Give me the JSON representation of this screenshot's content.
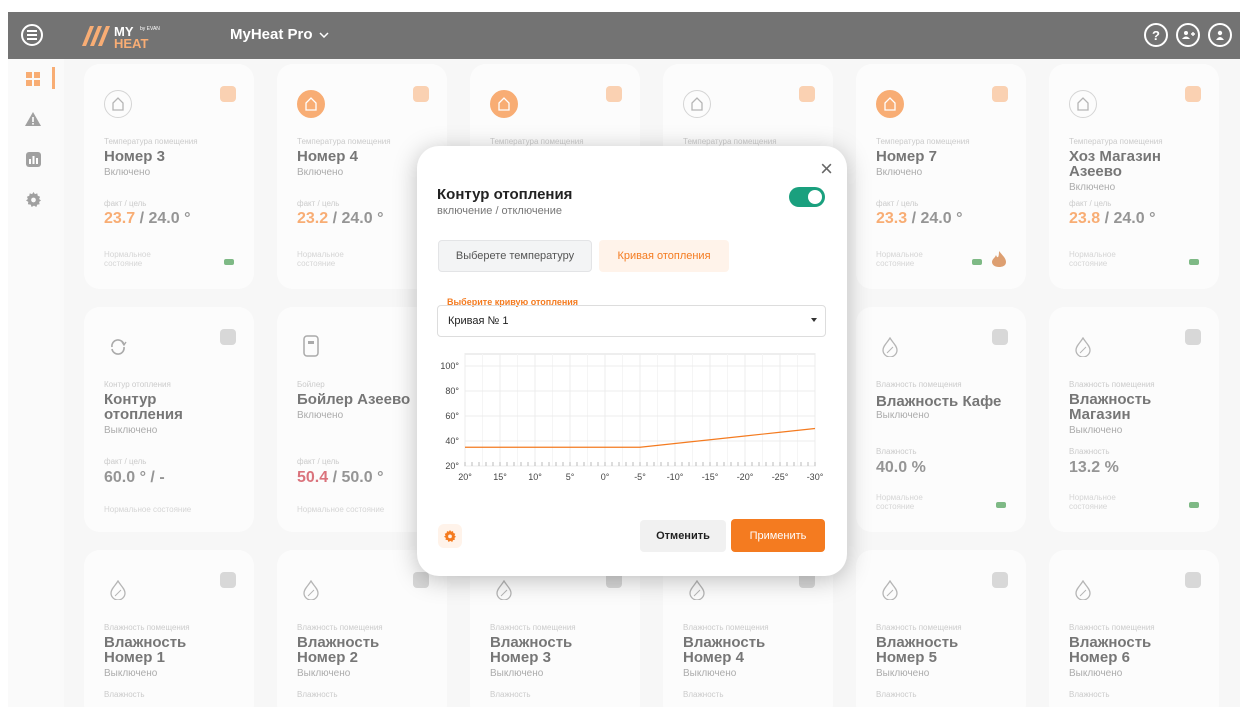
{
  "app": {
    "logo_text": "MY HEAT by EVAN",
    "title": "MyHeat Pro"
  },
  "topbar": {
    "help_icon": "question-icon",
    "help_label": "?",
    "add_user_icon": "add-user-icon",
    "add_user_label": "+",
    "profile_icon": "user-icon",
    "profile_label": "●"
  },
  "sidebar": {
    "items": [
      {
        "icon": "dashboard-icon",
        "active": true
      },
      {
        "icon": "warning-icon",
        "active": false
      },
      {
        "icon": "chart-icon",
        "active": false
      },
      {
        "icon": "gear-icon",
        "active": false
      }
    ]
  },
  "cards_row1": [
    {
      "caption": "Температура помещения",
      "name": "Номер 3",
      "state": "Включено",
      "fact_label": "факт / цель",
      "value_a": "23.7",
      "value_b": " / 24.0 °",
      "footer": "Нормальное состояние",
      "icon_on": false
    },
    {
      "caption": "Температура помещения",
      "name": "Номер 4",
      "state": "Включено",
      "fact_label": "факт / цель",
      "value_a": "23.2",
      "value_b": " / 24.0 °",
      "footer": "Нормальное состояние",
      "icon_on": true
    },
    {
      "caption": "Температура помещения",
      "name": "",
      "state": "",
      "fact_label": "",
      "value_a": "",
      "value_b": "",
      "footer": "",
      "icon_on": true
    },
    {
      "caption": "Температура помещения",
      "name": "",
      "state": "",
      "fact_label": "",
      "value_a": "",
      "value_b": "",
      "footer": "",
      "icon_on": false
    },
    {
      "caption": "Температура помещения",
      "name": "Номер 7",
      "state": "Включено",
      "fact_label": "факт / цель",
      "value_a": "23.3",
      "value_b": " / 24.0 °",
      "footer": "Нормальное состояние",
      "icon_on": true
    },
    {
      "caption": "Температура помещения",
      "name": "Хоз Магазин Азеево",
      "state": "Включено",
      "fact_label": "факт / цель",
      "value_a": "23.8",
      "value_b": " / 24.0 °",
      "footer": "Нормальное состояние",
      "icon_on": false
    }
  ],
  "cards_row2": [
    {
      "caption": "Контур отопления",
      "name": "Контур отопления",
      "state": "Выключено",
      "fact_label": "факт / цель",
      "value_a": "",
      "value_b": "60.0 ° / -",
      "footer": "Нормальное состояние"
    },
    {
      "caption": "Бойлер",
      "name": "Бойлер Азеево",
      "state": "Включено",
      "fact_label": "факт / цель",
      "value_a": "50.4",
      "value_b": " / 50.0 °",
      "footer": "Нормальное состояние"
    },
    {
      "caption": "Влажность помещения",
      "name": "Влажность Кафе",
      "state": "Выключено",
      "fact_label": "Влажность",
      "value_a": "",
      "value_b": "40.0 %",
      "footer": "Нормальное состояние"
    },
    {
      "caption": "Влажность помещения",
      "name": "Влажность Магазин",
      "state": "Выключено",
      "fact_label": "Влажность",
      "value_a": "",
      "value_b": "13.2 %",
      "footer": "Нормальное состояние"
    }
  ],
  "cards_row3": [
    {
      "caption": "Влажность помещения",
      "name": "Влажность Номер 1",
      "state": "Выключено",
      "fact_label": "Влажность"
    },
    {
      "caption": "Влажность помещения",
      "name": "Влажность Номер 2",
      "state": "Выключено",
      "fact_label": "Влажность"
    },
    {
      "caption": "Влажность помещения",
      "name": "Влажность Номер 3",
      "state": "Выключено",
      "fact_label": "Влажность"
    },
    {
      "caption": "Влажность помещения",
      "name": "Влажность Номер 4",
      "state": "Выключено",
      "fact_label": "Влажность"
    },
    {
      "caption": "Влажность помещения",
      "name": "Влажность Номер 5",
      "state": "Выключено",
      "fact_label": "Влажность"
    },
    {
      "caption": "Влажность помещения",
      "name": "Влажность Номер 6",
      "state": "Выключено",
      "fact_label": "Влажность"
    }
  ],
  "modal": {
    "close_icon": "close-icon",
    "close_label": "×",
    "title": "Контур отопления",
    "subtitle": "включение / отключение",
    "toggle_on": true,
    "tab_temperature": "Выберете температуру",
    "tab_curve": "Кривая отопления",
    "select_label": "Выберите кривую отопления",
    "select_value": "Кривая № 1",
    "settings_icon": "gear-icon",
    "cancel_label": "Отменить",
    "apply_label": "Применить"
  },
  "colors": {
    "accent": "#f47b20",
    "toggle": "#1aa07e",
    "dark_bar": "#1e1e1e"
  },
  "chart_data": {
    "type": "line",
    "x": [
      20,
      15,
      10,
      5,
      0,
      -5,
      -10,
      -15,
      -20,
      -25,
      -30
    ],
    "x_tick_labels": [
      "20°",
      "15°",
      "10°",
      "5°",
      "0°",
      "-5°",
      "-10°",
      "-15°",
      "-20°",
      "-25°",
      "-30°"
    ],
    "y_tick_labels": [
      "20°",
      "40°",
      "60°",
      "80°",
      "100°"
    ],
    "ylim": [
      20,
      100
    ],
    "xlim": [
      20,
      -30
    ],
    "series": [
      {
        "values": [
          35,
          35,
          35,
          35,
          35,
          35,
          38,
          41,
          44,
          47,
          50
        ]
      }
    ],
    "grid": true
  }
}
